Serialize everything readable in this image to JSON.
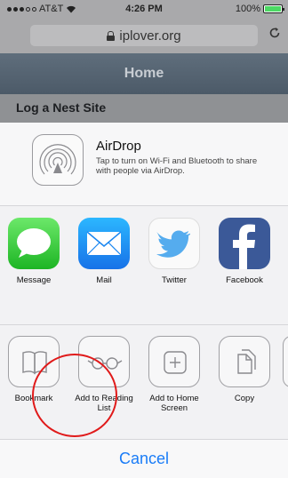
{
  "status_bar": {
    "carrier": "AT&T",
    "time": "4:26 PM",
    "battery": "100%",
    "battery_level": 1.0
  },
  "browser": {
    "url": "iplover.org",
    "reload_icon": "reload-icon"
  },
  "site": {
    "header_title": "Home",
    "section_title": "Log a Nest Site"
  },
  "share_sheet": {
    "airdrop": {
      "title": "AirDrop",
      "description": "Tap to turn on Wi-Fi and Bluetooth to share with people via AirDrop."
    },
    "apps": [
      {
        "label": "Message",
        "icon": "messages-icon",
        "color": "#2ecc40"
      },
      {
        "label": "Mail",
        "icon": "mail-icon",
        "color": "#1a86f0"
      },
      {
        "label": "Twitter",
        "icon": "twitter-icon",
        "color": "#55acee"
      },
      {
        "label": "Facebook",
        "icon": "facebook-icon",
        "color": "#3b5998"
      }
    ],
    "actions": [
      {
        "label": "Bookmark",
        "icon": "bookmark-icon"
      },
      {
        "label": "Add to Reading List",
        "icon": "reading-list-icon"
      },
      {
        "label": "Add to Home Screen",
        "icon": "add-to-home-screen-icon"
      },
      {
        "label": "Copy",
        "icon": "copy-icon"
      }
    ],
    "cancel_label": "Cancel"
  },
  "accent_color": "#1a7cf7",
  "annotation_color": "#e01a1a"
}
